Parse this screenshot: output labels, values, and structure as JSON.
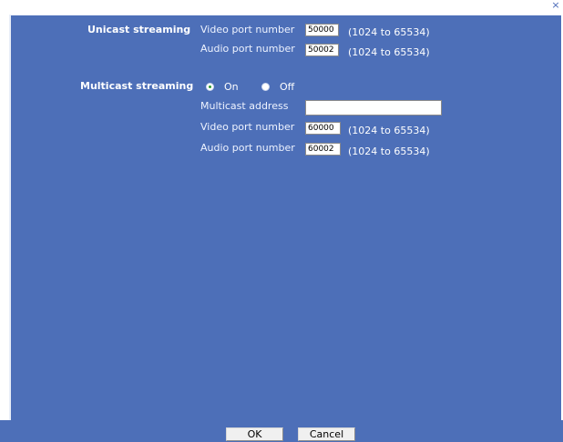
{
  "unicast": {
    "label": "Unicast streaming",
    "video_label": "Video port number",
    "video_value": "50000",
    "video_range": "(1024 to 65534)",
    "audio_label": "Audio port number",
    "audio_value": "50002",
    "audio_range": "(1024 to 65534)"
  },
  "multicast": {
    "label": "Multicast streaming",
    "option_on": "On",
    "option_off": "Off",
    "selected": "On",
    "address_label": "Multicast address",
    "address_value": "",
    "video_label": "Video port number",
    "video_value": "60000",
    "video_range": "(1024 to 65534)",
    "audio_label": "Audio port number",
    "audio_value": "60002",
    "audio_range": "(1024 to 65534)"
  },
  "buttons": {
    "ok": "OK",
    "cancel": "Cancel"
  },
  "colors": {
    "panel": "#4d6fb8",
    "text": "#ffffff"
  },
  "icons": {
    "top_right": "close-icon"
  }
}
